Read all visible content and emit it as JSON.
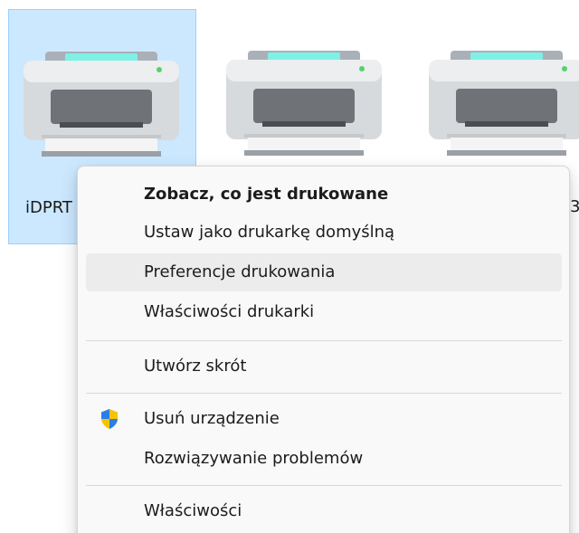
{
  "printers": [
    {
      "label": "iDPRT",
      "selected": true
    },
    {
      "label": "",
      "selected": false
    },
    {
      "label": "",
      "selected": false
    }
  ],
  "edge_text": "3",
  "context_menu": {
    "items": [
      {
        "label": "Zobacz, co jest drukowane",
        "bold": true
      },
      {
        "label": "Ustaw jako drukarkę domyślną"
      },
      {
        "label": "Preferencje drukowania",
        "hovered": true
      },
      {
        "label": "Właściwości drukarki"
      },
      {
        "label": "Utwórz skrót"
      },
      {
        "label": "Usuń urządzenie",
        "icon": "uac-shield-icon"
      },
      {
        "label": "Rozwiązywanie problemów"
      },
      {
        "label": "Właściwości"
      }
    ]
  },
  "colors": {
    "selection_bg": "#cce8ff",
    "selection_border": "#99d1ff",
    "menu_bg": "#f9f9f9",
    "hover_bg": "#ececec"
  }
}
